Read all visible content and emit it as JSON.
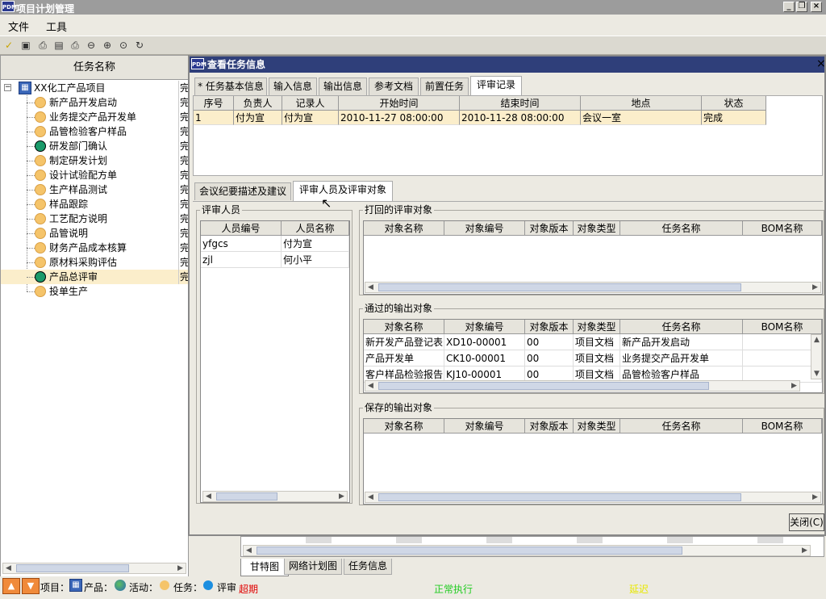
{
  "app": {
    "title": "项目计划管理",
    "logo": "PDM"
  },
  "menu": [
    "文件",
    "工具"
  ],
  "toolbar_icons": [
    "new-icon",
    "save-icon",
    "print-icon",
    "preview-icon",
    "printer-icon",
    "zoom-out-icon",
    "zoom-in-icon",
    "zoom-fit-icon",
    "refresh-icon"
  ],
  "left": {
    "header": "任务名称",
    "root": "XX化工产品项目",
    "root_status": "完",
    "items": [
      {
        "label": "新产品开发启动",
        "status": "完",
        "type": "task"
      },
      {
        "label": "业务提交产品开发单",
        "status": "完",
        "type": "task"
      },
      {
        "label": "品管检验客户样品",
        "status": "完",
        "type": "task"
      },
      {
        "label": "研发部门确认",
        "status": "完",
        "type": "review"
      },
      {
        "label": "制定研发计划",
        "status": "完",
        "type": "task"
      },
      {
        "label": "设计试验配方单",
        "status": "完",
        "type": "task"
      },
      {
        "label": "生产样品测试",
        "status": "完",
        "type": "task"
      },
      {
        "label": "样品跟踪",
        "status": "完",
        "type": "task"
      },
      {
        "label": "工艺配方说明",
        "status": "完",
        "type": "task"
      },
      {
        "label": "品管说明",
        "status": "完",
        "type": "task"
      },
      {
        "label": "财务产品成本核算",
        "status": "完",
        "type": "task"
      },
      {
        "label": "原材料采购评估",
        "status": "完",
        "type": "task"
      },
      {
        "label": "产品总评审",
        "status": "完",
        "type": "review",
        "selected": true
      },
      {
        "label": "投单生产",
        "status": "",
        "type": "task"
      }
    ]
  },
  "dialog": {
    "title": "查看任务信息",
    "tabs": [
      "* 任务基本信息",
      "输入信息",
      "输出信息",
      "参考文档",
      "前置任务",
      "评审记录"
    ],
    "active_tab": 5,
    "review_table": {
      "columns": [
        "序号",
        "负责人",
        "记录人",
        "开始时间",
        "结束时间",
        "地点",
        "状态"
      ],
      "rows": [
        [
          "1",
          "付为宣",
          "付为宣",
          "2010-11-27 08:00:00",
          "2010-11-28 08:00:00",
          "会议一室",
          "完成"
        ]
      ]
    },
    "subtabs": [
      "会议纪要描述及建议",
      "评审人员及评审对象"
    ],
    "active_subtab": 1,
    "reviewers": {
      "title": "评审人员",
      "columns": [
        "人员编号",
        "人员名称"
      ],
      "rows": [
        [
          "yfgcs",
          "付为宣"
        ],
        [
          "zjl",
          "何小平"
        ]
      ]
    },
    "rejected": {
      "title": "打回的评审对象",
      "columns": [
        "对象名称",
        "对象编号",
        "对象版本",
        "对象类型",
        "任务名称",
        "BOM名称"
      ],
      "rows": []
    },
    "passed": {
      "title": "通过的输出对象",
      "columns": [
        "对象名称",
        "对象编号",
        "对象版本",
        "对象类型",
        "任务名称",
        "BOM名称"
      ],
      "rows": [
        [
          "新开发产品登记表",
          "XD10-00001",
          "00",
          "项目文档",
          "新产品开发启动",
          ""
        ],
        [
          "产品开发单",
          "CK10-00001",
          "00",
          "项目文档",
          "业务提交产品开发单",
          ""
        ],
        [
          "客户样品检验报告",
          "KJ10-00001",
          "00",
          "项目文档",
          "品管检验客户样品",
          ""
        ]
      ]
    },
    "saved": {
      "title": "保存的输出对象",
      "columns": [
        "对象名称",
        "对象编号",
        "对象版本",
        "对象类型",
        "任务名称",
        "BOM名称"
      ],
      "rows": []
    },
    "close_button": "关闭(C)"
  },
  "bottom_tabs": [
    "甘特图",
    "网络计划图",
    "任务信息"
  ],
  "legend": {
    "project": "项目：",
    "product": "产品：",
    "activity": "活动：",
    "task": "任务：",
    "review": "评审"
  },
  "status_legend": [
    {
      "label": "超期",
      "color": "#e00000"
    },
    {
      "label": "正常执行",
      "color": "#22cc22"
    },
    {
      "label": "延迟",
      "color": "#e8e800"
    }
  ],
  "colors": {
    "title_bar": "#2f3f7a",
    "task": "#f5c46a",
    "review": "#1a9a6a",
    "selected_row": "#fbeecb"
  }
}
